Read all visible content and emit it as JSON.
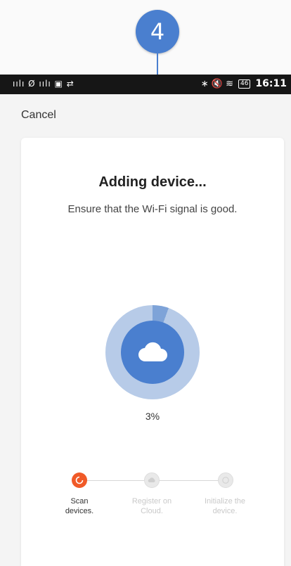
{
  "badge": {
    "step_number": "4"
  },
  "status_bar": {
    "left_icons": "ıılı Ø ıılı ▣ ⇄",
    "right_icons": "∗ 🔇 ≋",
    "battery": "46",
    "time": "16:11"
  },
  "header": {
    "cancel_label": "Cancel"
  },
  "main": {
    "title": "Adding device...",
    "subtitle": "Ensure that the Wi-Fi signal is good.",
    "progress_percent_label": "3%",
    "progress_value": 3
  },
  "steps": [
    {
      "label_line1": "Scan",
      "label_line2": "devices.",
      "state": "active",
      "icon": "refresh-icon"
    },
    {
      "label_line1": "Register on",
      "label_line2": "Cloud.",
      "state": "pending",
      "icon": "cloud-icon"
    },
    {
      "label_line1": "Initialize the",
      "label_line2": "device.",
      "state": "pending",
      "icon": "check-circle-icon"
    }
  ],
  "colors": {
    "accent_blue": "#4a7fcf",
    "ring_light": "#b7cbe8",
    "active_orange": "#f05a28",
    "status_bar": "#161616"
  }
}
